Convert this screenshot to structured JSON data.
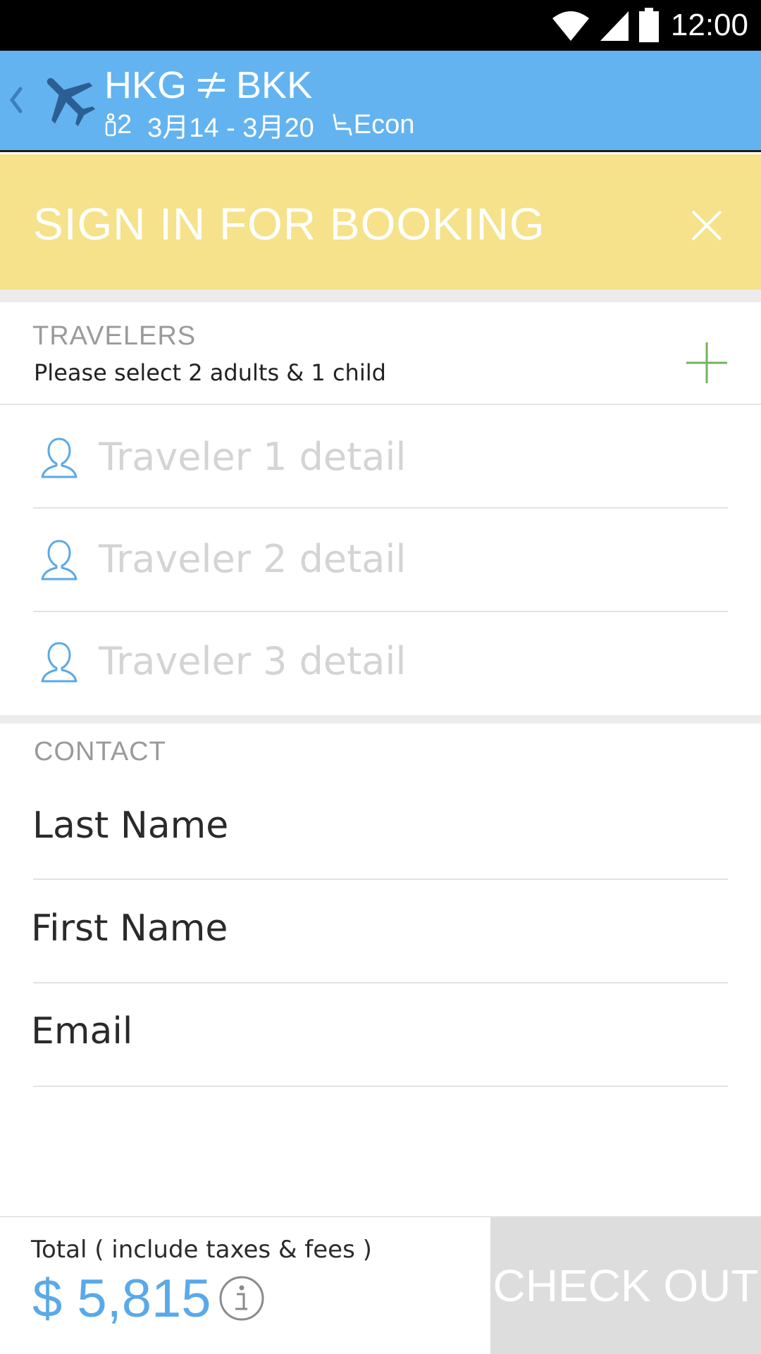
{
  "status_bar": {
    "time": "12:00",
    "icons": [
      "wifi-icon",
      "signal-icon",
      "battery-icon"
    ]
  },
  "header": {
    "origin": "HKG",
    "destination": "BKK",
    "passengers": "2",
    "dates": "3月14 - 3月20",
    "cabin": "Econ",
    "background_color": "#63b3f0"
  },
  "signin_banner": {
    "label": "SIGN IN FOR BOOKING",
    "background_color": "#f5e28a"
  },
  "travelers": {
    "section_label": "TRAVELERS",
    "hint": "Please select 2 adults & 1 child",
    "items": [
      {
        "placeholder": "Traveler 1 detail"
      },
      {
        "placeholder": "Traveler 2 detail"
      },
      {
        "placeholder": "Traveler 3 detail"
      }
    ]
  },
  "contact": {
    "section_label": "CONTACT",
    "last_name_placeholder": "Last Name",
    "first_name_placeholder": "First Name",
    "email_placeholder": "Email"
  },
  "footer": {
    "total_label": "Total ( include taxes & fees )",
    "total_price": "$ 5,815",
    "checkout_label": "CHECK OUT",
    "price_color": "#5aa9e8"
  }
}
